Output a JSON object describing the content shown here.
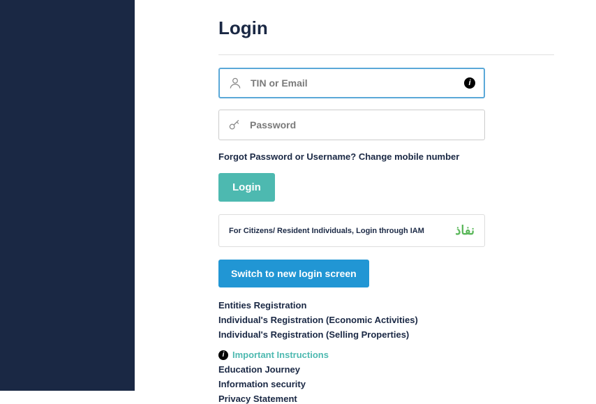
{
  "page": {
    "title": "Login"
  },
  "fields": {
    "username": {
      "placeholder": "TIN or Email",
      "value": ""
    },
    "password": {
      "placeholder": "Password",
      "value": ""
    }
  },
  "helpLinks": {
    "forgot": "Forgot Password or Username?",
    "changeMobile": "Change mobile number"
  },
  "buttons": {
    "login": "Login",
    "switch": "Switch to new login screen"
  },
  "iam": {
    "text": "For Citizens/ Resident Individuals, Login through IAM",
    "logo": "نفاذ"
  },
  "links": {
    "entities": "Entities Registration",
    "individualEcon": "Individual's Registration (Economic Activities)",
    "individualSell": "Individual's Registration (Selling Properties)",
    "important": "Important Instructions",
    "education": "Education Journey",
    "infosec": "Information security",
    "privacy": "Privacy Statement"
  }
}
